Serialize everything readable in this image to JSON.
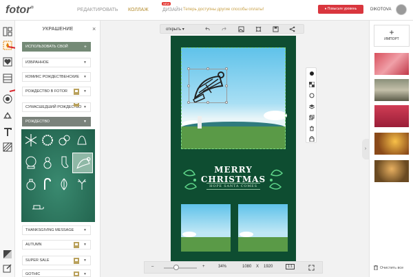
{
  "app": {
    "logo": "fotor",
    "logo_mark": "®"
  },
  "nav": {
    "edit": "РЕДАКТИРОВАТЬ",
    "collage": "КОЛЛАЖ",
    "design": "ДИЗАЙН",
    "new_badge": "NEW"
  },
  "promo": "Теперь доступны другие способы оплаты!",
  "premium": "Повысьте уровень",
  "user": {
    "name": "DIKOTOVA"
  },
  "panel": {
    "title": "УКРАШЕНИЕ",
    "close": "×",
    "rows": [
      {
        "label": "ИСПОЛЬЗОВАТЬ СВОЙ",
        "arrow": "+"
      },
      {
        "label": "ИЗБРАННОЕ",
        "arrow": "▼"
      },
      {
        "label": "КОМИКС РОЖДЕСТВЕНСКИЕ",
        "arrow": "▼"
      },
      {
        "label": "РОЖДЕСТВО В FOTOR",
        "arrow": "▼"
      },
      {
        "label": "СУМАСШЕДШИЙ РОЖДЕСТВО",
        "arrow": "▼"
      },
      {
        "label": "РОЖДЕСТВО",
        "arrow": "▼"
      },
      {
        "label": "THANKSGIVING MESSAGE",
        "arrow": "▼"
      },
      {
        "label": "AUTUMN",
        "arrow": "▼"
      },
      {
        "label": "SUPER SALE",
        "arrow": "▼"
      },
      {
        "label": "GOTHIC",
        "arrow": "▼"
      }
    ]
  },
  "canvas_toolbar": {
    "open": "открыть"
  },
  "card": {
    "line1": "MERRY",
    "line2": "CHRISTMAS",
    "line3": "HOPE SANTA COMES"
  },
  "zoom": {
    "minus": "–",
    "plus": "+",
    "percent": "34%",
    "width": "1080",
    "x": "X",
    "height": "1920",
    "ratio": "1:1",
    "level": 0.34
  },
  "right": {
    "import": "ИМПОРТ",
    "import_plus": "+",
    "clear": "Очистить все",
    "expand": "›"
  },
  "colors": {
    "accent": "#b38b2c",
    "premium": "#d9363e",
    "card_bg": "#0e4d31",
    "green_row": "#748a76"
  }
}
